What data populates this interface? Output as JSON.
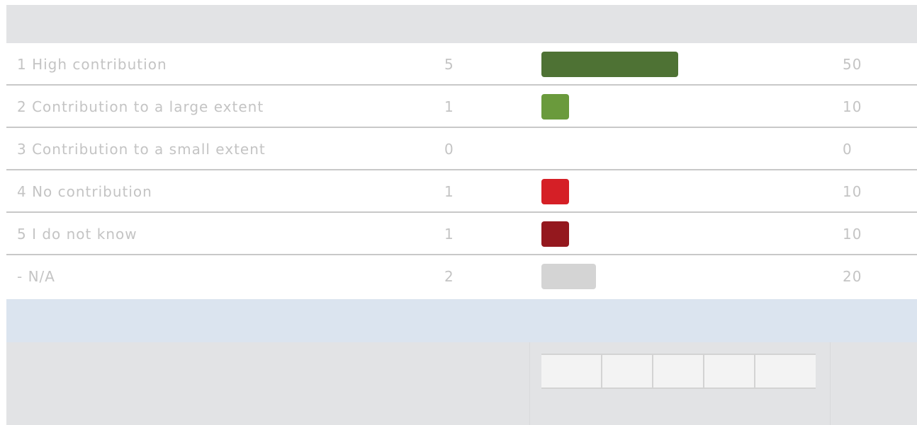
{
  "chart_data": {
    "type": "bar",
    "categories": [
      "1 High contribution",
      "2 Contribution to a large extent",
      "3 Contribution to a small extent",
      "4 No contribution",
      "5 I do not know",
      "- N/A"
    ],
    "counts": [
      "5",
      "1",
      "0",
      "1",
      "1",
      "2"
    ],
    "values": [
      50,
      10,
      0,
      10,
      10,
      20
    ],
    "value_labels": [
      "50",
      "10",
      "0",
      "10",
      "10",
      "20"
    ],
    "colors": [
      "#4e7234",
      "#6a9a3c",
      "#ffffff",
      "#d51f26",
      "#94181e",
      "#d4d4d4"
    ],
    "xlim": [
      0,
      100
    ]
  }
}
